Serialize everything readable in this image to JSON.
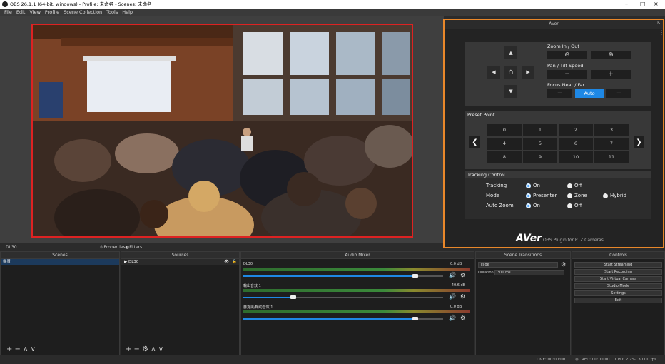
{
  "window": {
    "title": "OBS 26.1.1 (64-bit, windows) - Profile: 未命名 - Scenes: 未命名",
    "minimize": "–",
    "maximize": "□",
    "close": "×"
  },
  "menu": [
    "File",
    "Edit",
    "View",
    "Profile",
    "Scene Collection",
    "Tools",
    "Help"
  ],
  "aver": {
    "title": "AVer",
    "zoom_label": "Zoom In / Out",
    "zoom_out": "⊖",
    "zoom_in": "⊕",
    "pan_label": "Pan / Tilt Speed",
    "pan_minus": "−",
    "pan_plus": "+",
    "focus_label": "Focus Near / Far",
    "focus_near": "−",
    "focus_auto": "Auto",
    "focus_far": "+",
    "up": "▲",
    "down": "▼",
    "left": "◀",
    "right": "▶",
    "home": "⌂",
    "preset_title": "Preset Point",
    "presets": [
      "0",
      "1",
      "2",
      "3",
      "4",
      "5",
      "6",
      "7",
      "8",
      "9",
      "10",
      "11"
    ],
    "prev": "❮",
    "next": "❯",
    "tracking_title": "Tracking Control",
    "tracking_label": "Tracking",
    "tracking_on": "On",
    "tracking_off": "Off",
    "mode_label": "Mode",
    "mode_presenter": "Presenter",
    "mode_zone": "Zone",
    "mode_hybrid": "Hybrid",
    "autozoom_label": "Auto Zoom",
    "autozoom_on": "On",
    "autozoom_off": "Off",
    "brand": "AVer",
    "brand_sub": "OBS Plugin for PTZ Cameras"
  },
  "source_bar": {
    "name": "DL30",
    "properties": "Properties",
    "filters": "Filters"
  },
  "scenes": {
    "title": "Scenes",
    "items": [
      "場景"
    ],
    "footer": "+ − ∧ ∨"
  },
  "sources": {
    "title": "Sources",
    "items": [
      "DL30"
    ],
    "footer": "+ − ⚙ ∧ ∨"
  },
  "mixer": {
    "title": "Audio Mixer",
    "channels": [
      {
        "name": "DL30",
        "db": "0.0 dB",
        "level": 0.86
      },
      {
        "name": "輸出音效 1",
        "db": "-40.6 dB",
        "level": 0.25
      },
      {
        "name": "麥克風/輔助音效 1",
        "db": "0.0 dB",
        "level": 0.86
      }
    ]
  },
  "transitions": {
    "title": "Scene Transitions",
    "type": "Fade",
    "duration_label": "Duration",
    "duration": "300 ms"
  },
  "controls": {
    "title": "Controls",
    "buttons": [
      "Start Streaming",
      "Start Recording",
      "Start Virtual Camera",
      "Studio Mode",
      "Settings",
      "Exit"
    ]
  },
  "status": {
    "live": "LIVE: 00:00:00",
    "rec": "REC: 00:00:00",
    "cpu": "CPU: 2.7%, 30.00 fps"
  },
  "colors": {
    "accent": "#e8872a",
    "preview_border": "#dd2222",
    "active_blue": "#1e88e5"
  }
}
